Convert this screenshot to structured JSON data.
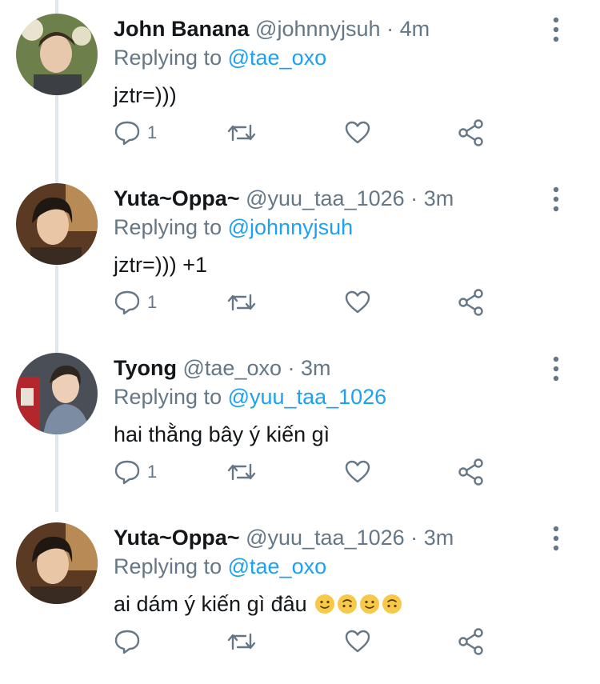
{
  "tweets": [
    {
      "name": "John Banana",
      "handle": "@johnnyjsuh",
      "dot": "·",
      "time": "4m",
      "replying_prefix": "Replying to",
      "replying_handle": "@tae_oxo",
      "text": "jztr=)))",
      "reply_count": "1"
    },
    {
      "name": "Yuta~Oppa~",
      "handle": "@yuu_taa_1026",
      "dot": "·",
      "time": "3m",
      "replying_prefix": "Replying to",
      "replying_handle": "@johnnyjsuh",
      "text": "jztr=))) +1",
      "reply_count": "1"
    },
    {
      "name": "Tyong",
      "handle": "@tae_oxo",
      "dot": "·",
      "time": "3m",
      "replying_prefix": "Replying to",
      "replying_handle": "@yuu_taa_1026",
      "text": "hai thằng bây ý kiến gì",
      "reply_count": "1"
    },
    {
      "name": "Yuta~Oppa~",
      "handle": "@yuu_taa_1026",
      "dot": "·",
      "time": "3m",
      "replying_prefix": "Replying to",
      "replying_handle": "@tae_oxo",
      "text": "ai dám ý kiến gì đâu",
      "reply_count": ""
    }
  ],
  "colors": {
    "link": "#1da1f2",
    "muted": "#657786",
    "text": "#14171a",
    "thread_line": "#e1e8ed"
  },
  "icons": [
    "reply-icon",
    "retweet-icon",
    "like-icon",
    "share-icon",
    "more-options-icon"
  ]
}
